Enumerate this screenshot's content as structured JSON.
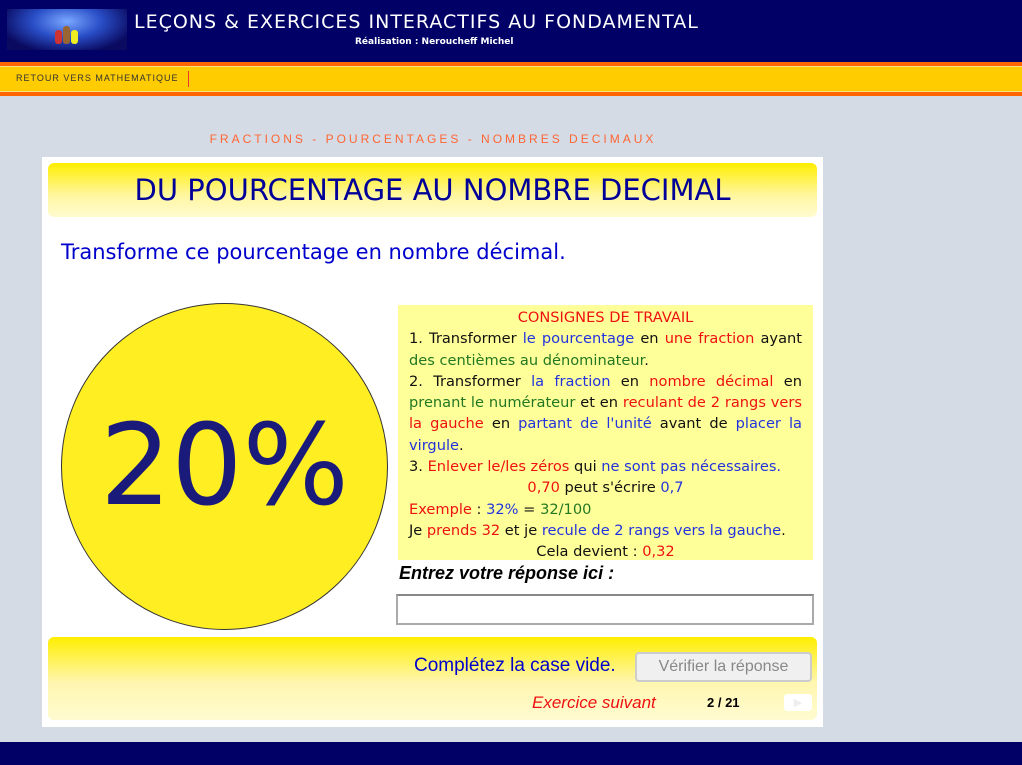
{
  "header": {
    "title": "LEÇONS & EXERCICES INTERACTIFS AU FONDAMENTAL",
    "subtitle": "Réalisation : Neroucheff Michel"
  },
  "nav": {
    "back_link": "RETOUR VERS MATHEMATIQUE"
  },
  "section": "FRACTIONS - POURCENTAGES - NOMBRES DECIMAUX",
  "exercise": {
    "title": "DU POURCENTAGE AU NOMBRE DECIMAL",
    "prompt": "Transforme ce pourcentage en nombre décimal.",
    "value": "20%",
    "rules_title": "CONSIGNES DE TRAVAIL",
    "rules": [
      {
        "align": "justify",
        "segments": [
          [
            "1. Transformer ",
            "#111111"
          ],
          [
            "le pourcentage",
            "#2233dd"
          ],
          [
            " en ",
            "#111111"
          ],
          [
            "une fraction",
            "#ee1111"
          ],
          [
            " ayant ",
            "#111111"
          ],
          [
            "des centièmes au dénominateur",
            "#227722"
          ],
          [
            ".",
            "#111111"
          ]
        ]
      },
      {
        "align": "justify",
        "segments": [
          [
            "2. Transformer ",
            "#111111"
          ],
          [
            "la fraction",
            "#2233dd"
          ],
          [
            " en ",
            "#111111"
          ],
          [
            "nombre décimal",
            "#ee1111"
          ],
          [
            " en ",
            "#111111"
          ],
          [
            "prenant le numérateur",
            "#227722"
          ],
          [
            " et en ",
            "#111111"
          ],
          [
            "reculant de 2 rangs vers la gauche",
            "#ee1111"
          ],
          [
            " en ",
            "#111111"
          ],
          [
            "partant de l'unité",
            "#2233dd"
          ],
          [
            " avant de ",
            "#111111"
          ],
          [
            "placer la virgule",
            "#2233dd"
          ],
          [
            ".",
            "#111111"
          ]
        ]
      },
      {
        "align": "left",
        "segments": [
          [
            "3. ",
            "#111111"
          ],
          [
            "Enlever le/les zéros",
            "#ee1111"
          ],
          [
            " qui ",
            "#111111"
          ],
          [
            "ne sont pas nécessaires.",
            "#2233dd"
          ]
        ]
      },
      {
        "align": "center",
        "segments": [
          [
            "0,70",
            "#ee1111"
          ],
          [
            " peut s'écrire ",
            "#111111"
          ],
          [
            "0,7",
            "#2233dd"
          ]
        ]
      },
      {
        "align": "left",
        "segments": [
          [
            "Exemple",
            "#ee1111"
          ],
          [
            " : ",
            "#111111"
          ],
          [
            "32%",
            "#2233dd"
          ],
          [
            " = ",
            "#111111"
          ],
          [
            "32/100",
            "#227722"
          ]
        ]
      },
      {
        "align": "left",
        "segments": [
          [
            "Je ",
            "#111111"
          ],
          [
            "prends 32",
            "#ee1111"
          ],
          [
            " et je ",
            "#111111"
          ],
          [
            "recule de 2 rangs vers la gauche",
            "#2233dd"
          ],
          [
            ".",
            "#111111"
          ]
        ]
      },
      {
        "align": "center",
        "segments": [
          [
            "Cela devient : ",
            "#111111"
          ],
          [
            "0,32",
            "#ee1111"
          ]
        ]
      }
    ],
    "answer_label": "Entrez votre réponse ici :",
    "answer_value": "",
    "status": "Complétez la case vide.",
    "verify_label": "Vérifier la réponse",
    "next_label": "Exercice suivant",
    "counter": "2 / 21",
    "next_icon": "play-arrow-icon"
  }
}
